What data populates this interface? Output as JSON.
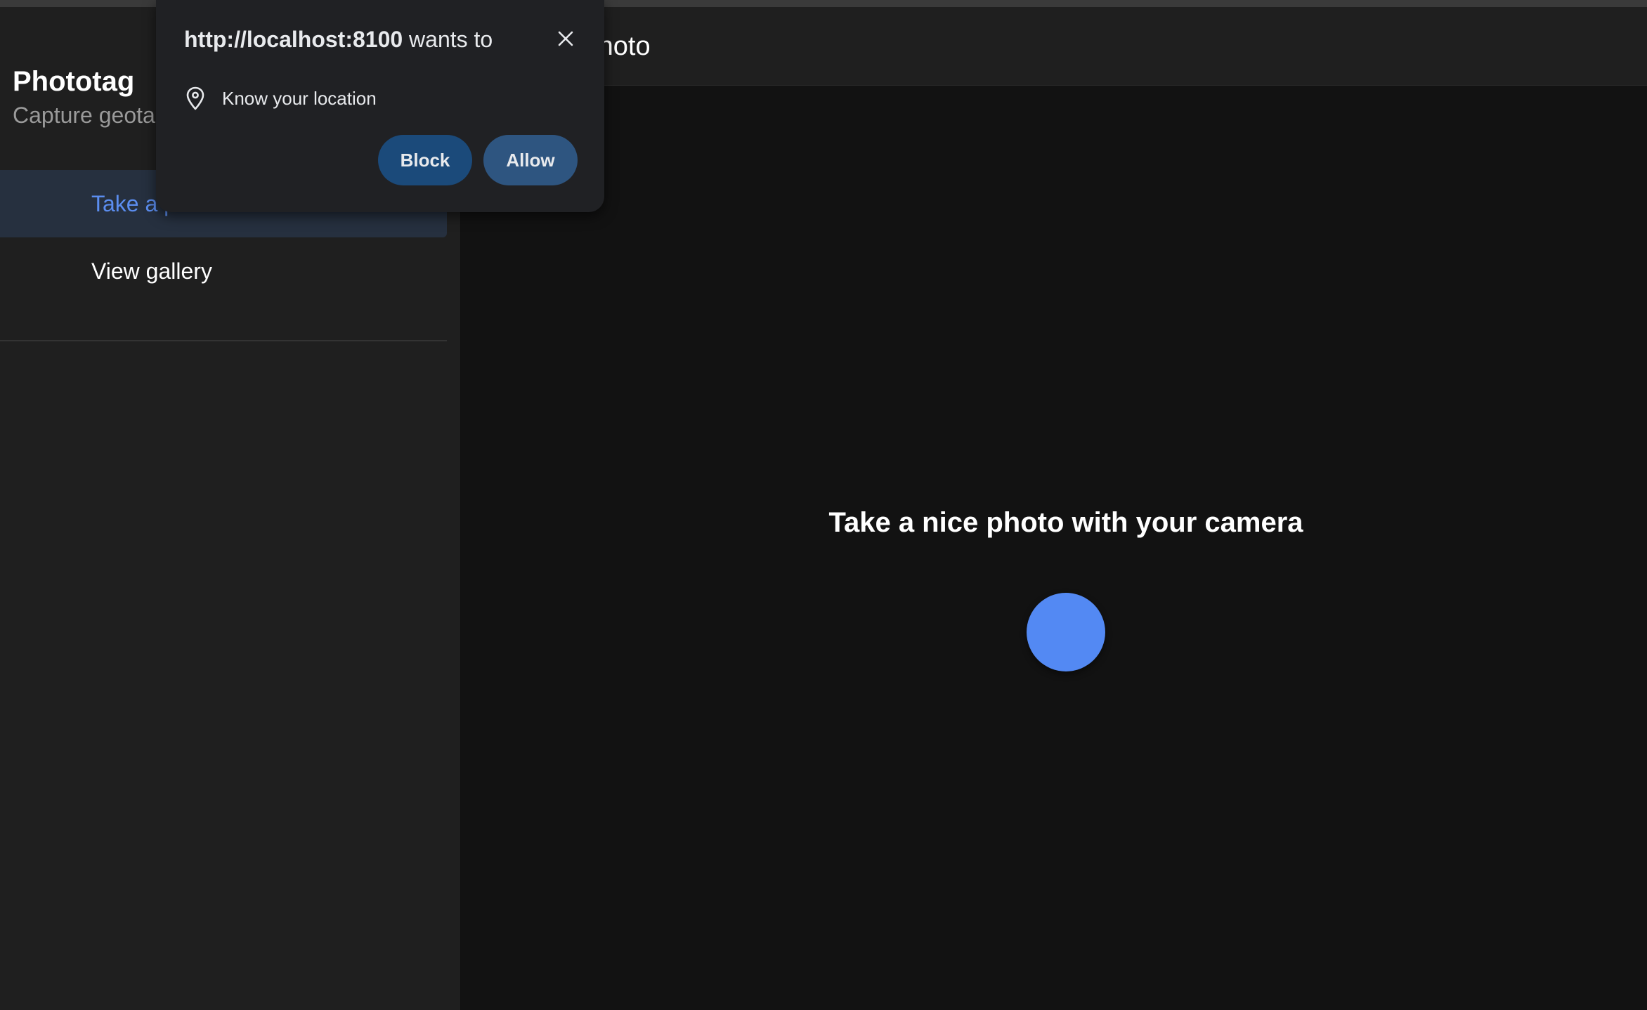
{
  "sidebar": {
    "title": "Phototag",
    "subtitle": "Capture geotagged photos",
    "items": [
      {
        "label": "Take a photo",
        "active": true
      },
      {
        "label": "View gallery",
        "active": false
      }
    ]
  },
  "toolbar": {
    "title": "Take a photo"
  },
  "main": {
    "heading": "Take a nice photo with your camera",
    "capture_color": "#5389f3"
  },
  "permission_popup": {
    "origin": "http://localhost:8100",
    "suffix": " wants to",
    "permission": "Know your location",
    "block_label": "Block",
    "allow_label": "Allow",
    "icon": "location-pin-icon"
  }
}
